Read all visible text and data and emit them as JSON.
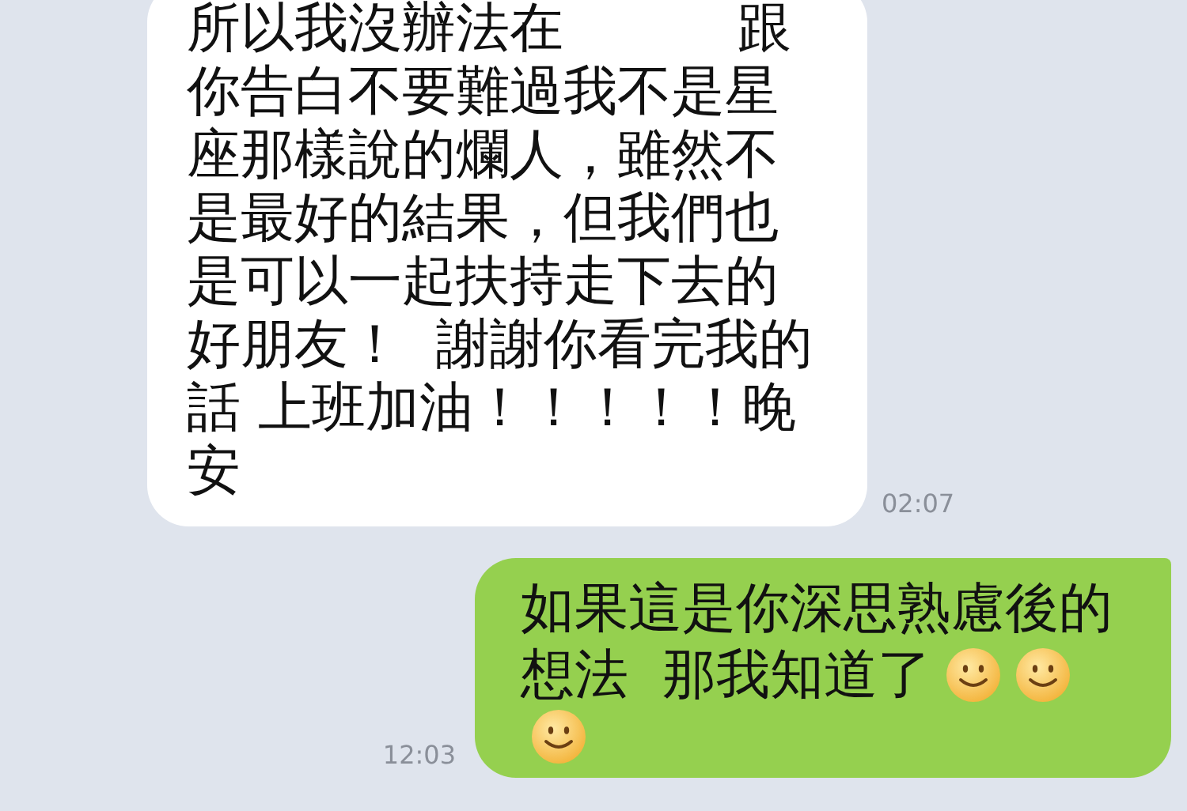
{
  "messages": [
    {
      "kind": "incoming",
      "lines": [
        {
          "parts": [
            "所以我沒辦法在",
            "跟"
          ]
        },
        {
          "text": "你告白不要難過我不是星"
        },
        {
          "text": "座那樣說的爛人，雖然不"
        },
        {
          "text": "是最好的結果，但我們也"
        },
        {
          "text": "是可以一起扶持走下去的"
        },
        {
          "text": "好朋友！  謝謝你看完我的"
        },
        {
          "text": "話 上班加油！！！！！晚"
        },
        {
          "text": "安"
        }
      ],
      "time": "02:07"
    },
    {
      "kind": "outgoing",
      "lines": [
        {
          "text": "如果這是你深思熟慮後的"
        },
        {
          "text": "想法  那我知道了",
          "emojis": [
            {
              "kind": "smile"
            },
            {
              "kind": "smile"
            }
          ]
        },
        {
          "emojis": [
            {
              "kind": "smile"
            }
          ]
        }
      ],
      "time": "12:03"
    }
  ]
}
